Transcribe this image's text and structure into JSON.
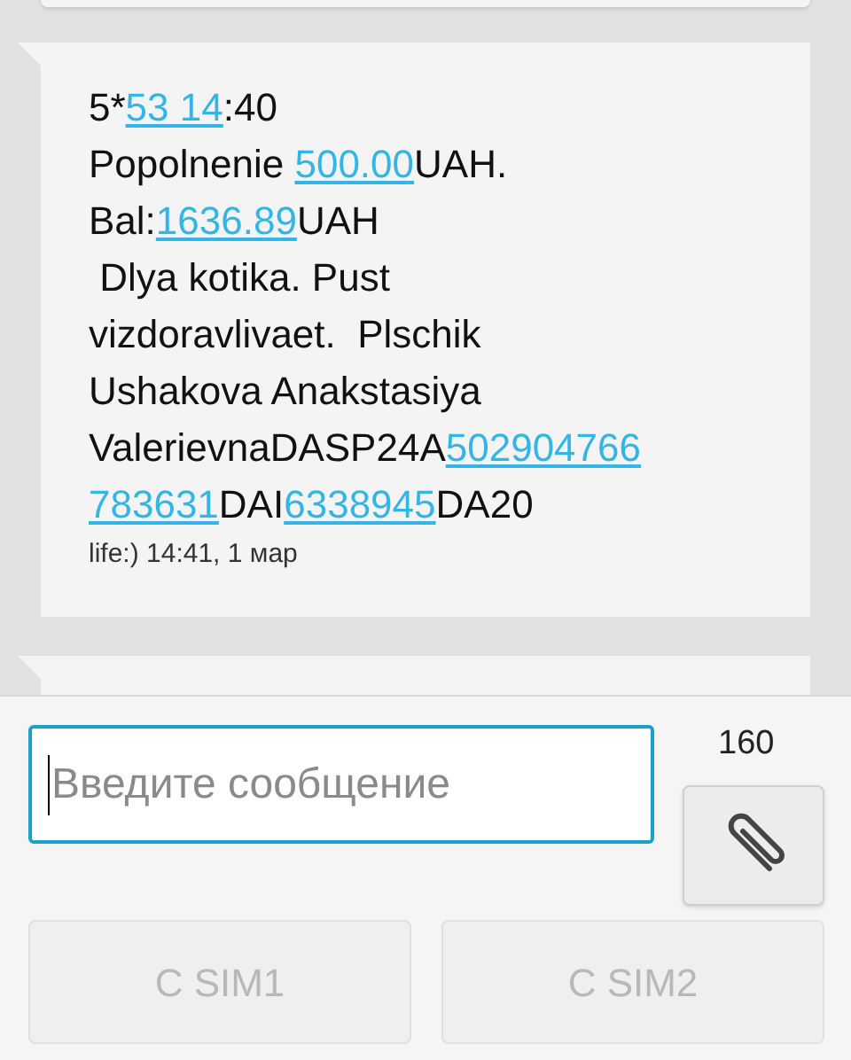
{
  "message": {
    "lines": [
      [
        {
          "text": "5*",
          "link": false
        },
        {
          "text": "53 14",
          "link": true
        },
        {
          "text": ":40",
          "link": false
        }
      ],
      [
        {
          "text": "Popolnenie ",
          "link": false
        },
        {
          "text": "500.00",
          "link": true
        },
        {
          "text": "UAH.",
          "link": false
        }
      ],
      [
        {
          "text": "Bal:",
          "link": false
        },
        {
          "text": "1636.89",
          "link": true
        },
        {
          "text": "UAH",
          "link": false
        }
      ],
      [
        {
          "text": " Dlya kotika. Pust",
          "link": false
        }
      ],
      [
        {
          "text": "vizdoravlivaet.  Plschik",
          "link": false
        }
      ],
      [
        {
          "text": "Ushakova Anakstasiya",
          "link": false
        }
      ],
      [
        {
          "text": "ValerievnaDASP24A",
          "link": false
        },
        {
          "text": "502904766",
          "link": true
        }
      ],
      [
        {
          "text": "783631",
          "link": true
        },
        {
          "text": "DAI",
          "link": false
        },
        {
          "text": "6338945",
          "link": true
        },
        {
          "text": "DA20",
          "link": false
        }
      ]
    ],
    "meta": "life:) 14:41, 1 мар"
  },
  "composer": {
    "placeholder": "Введите сообщение",
    "counter": "160"
  },
  "send_buttons": [
    {
      "label": "С SIM1",
      "disabled": true
    },
    {
      "label": "С SIM2",
      "disabled": true
    }
  ]
}
